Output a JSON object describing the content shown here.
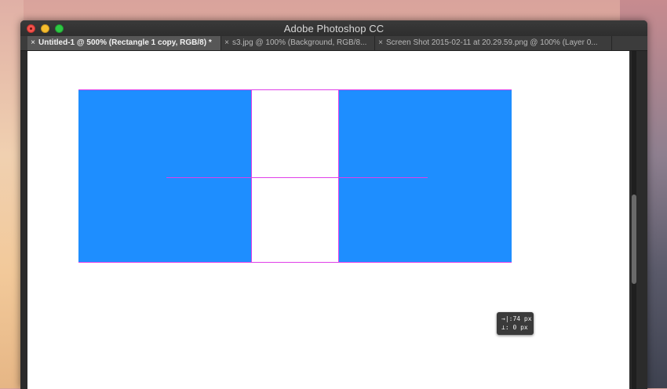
{
  "window": {
    "title": "Adobe Photoshop CC"
  },
  "tabs": [
    {
      "close": "×",
      "label": "Untitled-1 @ 500% (Rectangle 1 copy, RGB/8) *",
      "active": true
    },
    {
      "close": "×",
      "label": "s3.jpg @ 100% (Background, RGB/8...",
      "active": false
    },
    {
      "close": "×",
      "label": "Screen Shot 2015-02-11 at 20.29.59.png @ 100% (Layer 0...",
      "active": false
    }
  ],
  "canvas": {
    "rectangle_color": "#1e8eff",
    "guide_color": "#e040e8"
  },
  "measure_tooltip": {
    "width_icon": "→|",
    "width_value": "74 px",
    "height_icon": "⊥",
    "height_value": "0 px"
  }
}
